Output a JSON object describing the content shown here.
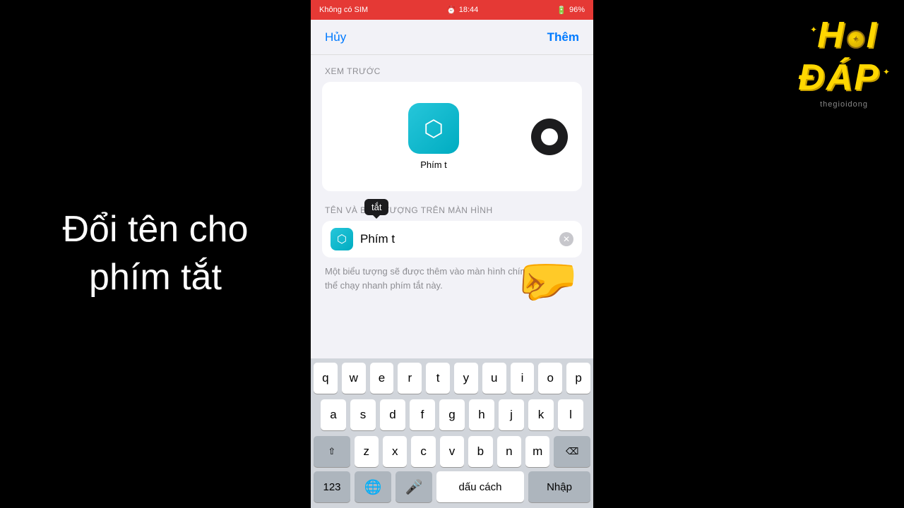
{
  "status_bar": {
    "left": "Không có SIM",
    "center_icon": "⏰",
    "time": "18:44",
    "battery_icon": "🔋",
    "battery_percent": "96%"
  },
  "nav": {
    "cancel_label": "Hủy",
    "add_label": "Thêm"
  },
  "preview_section": {
    "label": "XEM TRƯỚC",
    "app_name": "Phím t"
  },
  "name_section": {
    "label": "TÊN VÀ BIỂU TƯỢNG TRÊN MÀN HÌNH",
    "input_value": "Phím t",
    "tooltip": "tắt"
  },
  "hint": "Một biểu tượng sẽ được thêm vào màn hình chính để bạn có thể chạy nhanh phím tắt này.",
  "keyboard": {
    "row1": [
      "q",
      "w",
      "e",
      "r",
      "t",
      "y",
      "u",
      "i",
      "o",
      "p"
    ],
    "row2": [
      "a",
      "s",
      "d",
      "f",
      "g",
      "h",
      "j",
      "k",
      "l"
    ],
    "row3": [
      "z",
      "x",
      "c",
      "v",
      "b",
      "n",
      "m"
    ],
    "num_label": "123",
    "globe_label": "🌐",
    "mic_label": "🎤",
    "space_label": "dấu cách",
    "enter_label": "Nhập"
  },
  "left_text": "Đổi tên cho\nphím tắt",
  "logo": {
    "hoi": "HỎI",
    "dap": "ĐÁP",
    "subtitle": "thegioidong"
  }
}
